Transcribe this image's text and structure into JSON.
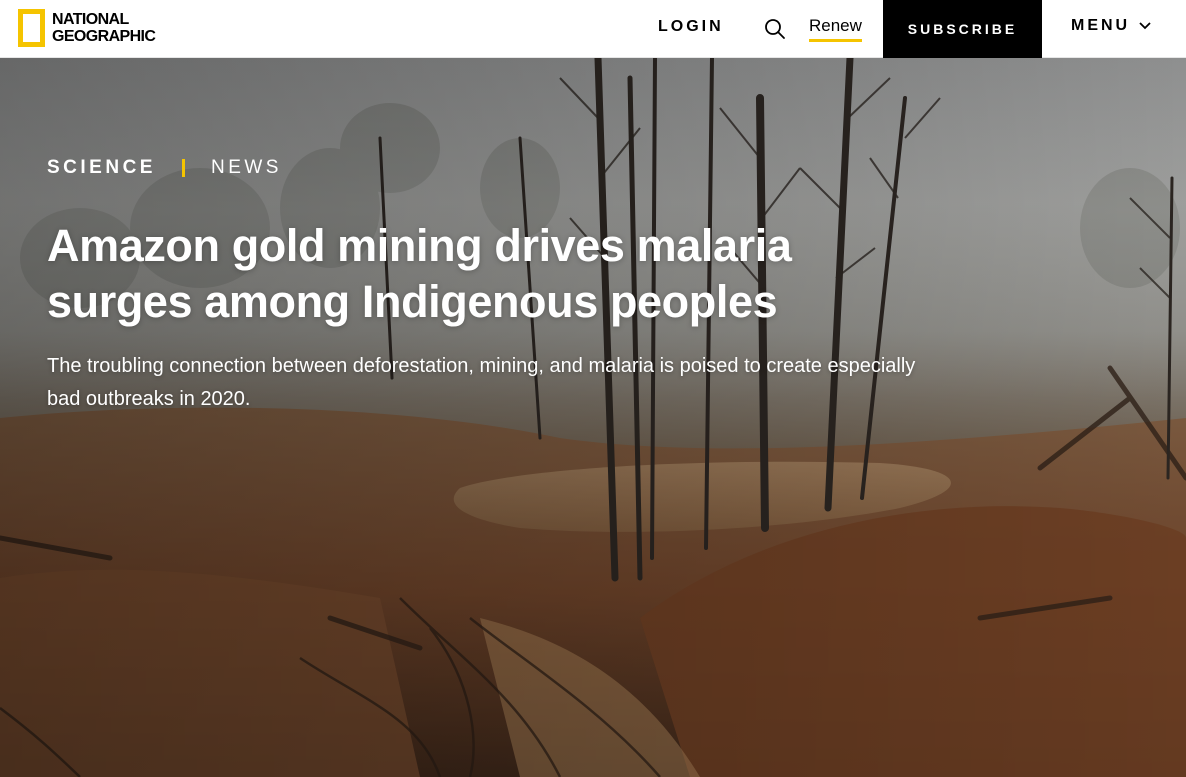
{
  "header": {
    "logo_line1": "NATIONAL",
    "logo_line2": "GEOGRAPHIC",
    "login_label": "LOGIN",
    "search_icon": "search-icon",
    "renew_label": "Renew",
    "subscribe_label": "SUBSCRIBE",
    "menu_label": "MENU",
    "menu_icon": "chevron-down-icon"
  },
  "article": {
    "section": "SCIENCE",
    "category": "NEWS",
    "headline": "Amazon gold mining drives malaria surges among Indigenous peoples",
    "dek": "The troubling connection between deforestation, mining, and malaria is poised to create especially bad outbreaks in 2020."
  },
  "colors": {
    "accent_yellow": "#f5c400",
    "subscribe_bg": "#000000",
    "header_bg": "#ffffff"
  }
}
